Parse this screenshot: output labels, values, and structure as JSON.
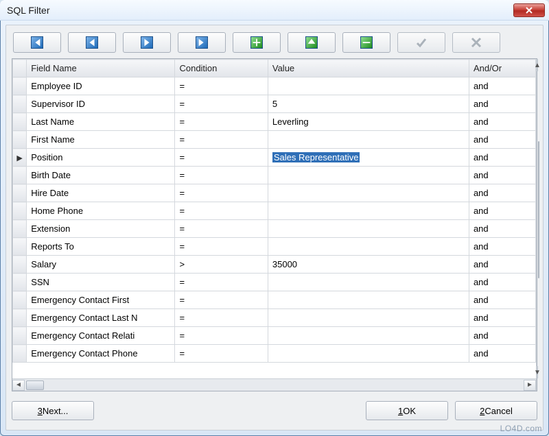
{
  "window": {
    "title": "SQL Filter"
  },
  "toolbar": {
    "icons": [
      "first-icon",
      "prev-icon",
      "next-icon",
      "last-icon",
      "add-icon",
      "apply-icon",
      "remove-icon",
      "accept-icon",
      "cancel-icon"
    ]
  },
  "columns": {
    "field": "Field Name",
    "condition": "Condition",
    "value": "Value",
    "andor": "And/Or"
  },
  "rows": [
    {
      "field": "Employee ID",
      "condition": "=",
      "value": "",
      "andor": "and",
      "current": false
    },
    {
      "field": "Supervisor ID",
      "condition": "=",
      "value": "5",
      "andor": "and",
      "current": false
    },
    {
      "field": "Last Name",
      "condition": "=",
      "value": "Leverling",
      "andor": "and",
      "current": false
    },
    {
      "field": "First Name",
      "condition": "=",
      "value": "",
      "andor": "and",
      "current": false
    },
    {
      "field": "Position",
      "condition": "=",
      "value": "Sales Representative",
      "andor": "and",
      "current": true,
      "selected": true
    },
    {
      "field": "Birth Date",
      "condition": "=",
      "value": "",
      "andor": "and",
      "current": false
    },
    {
      "field": "Hire Date",
      "condition": "=",
      "value": "",
      "andor": "and",
      "current": false
    },
    {
      "field": "Home Phone",
      "condition": "=",
      "value": "",
      "andor": "and",
      "current": false
    },
    {
      "field": "Extension",
      "condition": "=",
      "value": "",
      "andor": "and",
      "current": false
    },
    {
      "field": "Reports To",
      "condition": "=",
      "value": "",
      "andor": "and",
      "current": false
    },
    {
      "field": "Salary",
      "condition": ">",
      "value": "35000",
      "andor": "and",
      "current": false
    },
    {
      "field": "SSN",
      "condition": "=",
      "value": "",
      "andor": "and",
      "current": false
    },
    {
      "field": "Emergency Contact First",
      "condition": "=",
      "value": "",
      "andor": "and",
      "current": false
    },
    {
      "field": "Emergency Contact Last N",
      "condition": "=",
      "value": "",
      "andor": "and",
      "current": false
    },
    {
      "field": "Emergency Contact Relati",
      "condition": "=",
      "value": "",
      "andor": "and",
      "current": false
    },
    {
      "field": "Emergency Contact Phone",
      "condition": "=",
      "value": "",
      "andor": "and",
      "current": false
    }
  ],
  "footer": {
    "next_digit": "3",
    "next_text": " Next...",
    "ok_digit": "1",
    "ok_text": " OK",
    "cancel_digit": "2",
    "cancel_text": " Cancel"
  },
  "watermark": "LO4D.com"
}
